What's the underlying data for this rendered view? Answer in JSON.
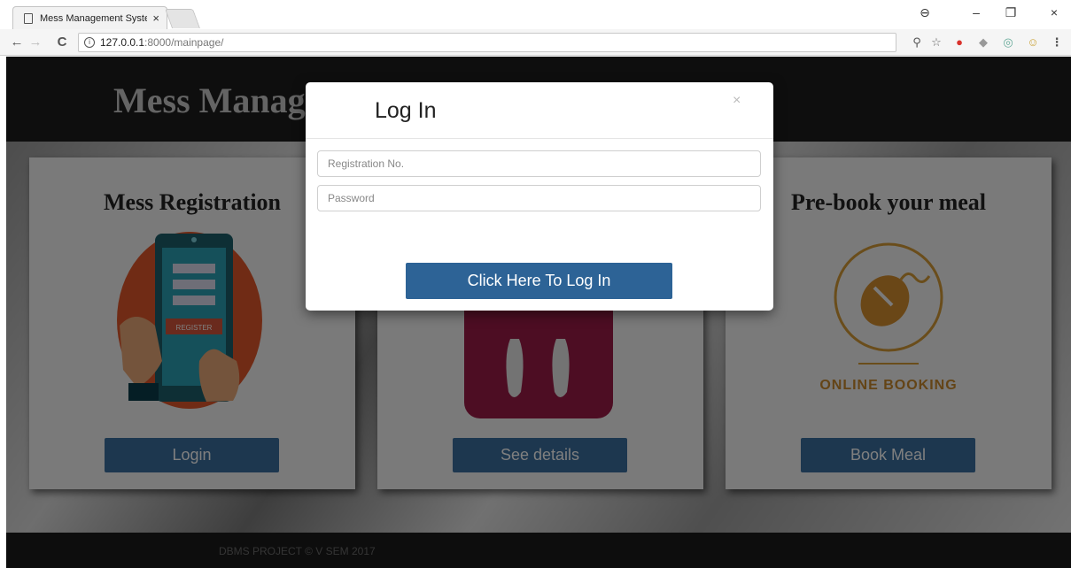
{
  "browser": {
    "tab_title": "Mess Management Syste",
    "tab_close": "×",
    "url_host": "127.0.0.1",
    "url_path": ":8000/mainpage/",
    "nav": {
      "back": "←",
      "forward": "→",
      "reload": "C"
    },
    "window": {
      "profile": "⊖",
      "minimize": "–",
      "maximize": "❐",
      "close": "×"
    },
    "extensions": [
      "⚲",
      "☆",
      "●",
      "◆",
      "◎",
      "☺",
      "⋮"
    ]
  },
  "page": {
    "site_title": "Mess Management System",
    "footer": "DBMS PROJECT © V SEM 2017",
    "cards": [
      {
        "title": "Mess Registration",
        "button": "Login",
        "icon": "tablet-register-icon"
      },
      {
        "title": "",
        "button": "See details",
        "icon": "fork-spoon-icon"
      },
      {
        "title": "Pre-book your meal",
        "button": "Book Meal",
        "icon": "online-booking-mouse-icon",
        "badge_label": "ONLINE BOOKING",
        "register_label": "REGISTER"
      }
    ]
  },
  "modal": {
    "title": "Log In",
    "close": "×",
    "reg_placeholder": "Registration No.",
    "password_placeholder": "Password",
    "submit": "Click Here To Log In"
  },
  "colors": {
    "primary_button": "#3a6f9f",
    "submit_button": "#2d6396",
    "header_bg": "#1d1d1d",
    "booking_accent": "#c8892d",
    "plate_color": "#9b1b46"
  }
}
